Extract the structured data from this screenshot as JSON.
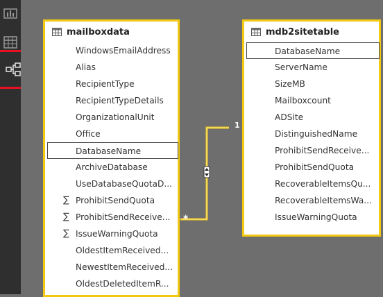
{
  "sidebar": {
    "icons": [
      {
        "name": "report-view-icon",
        "selected": false
      },
      {
        "name": "data-view-icon",
        "selected": false
      },
      {
        "name": "relationships-view-icon",
        "selected": true
      }
    ]
  },
  "tables": {
    "mailboxdata": {
      "title": "mailboxdata",
      "fields": [
        {
          "label": "WindowsEmailAddress",
          "sum": false,
          "selected": false
        },
        {
          "label": "Alias",
          "sum": false,
          "selected": false
        },
        {
          "label": "RecipientType",
          "sum": false,
          "selected": false
        },
        {
          "label": "RecipientTypeDetails",
          "sum": false,
          "selected": false
        },
        {
          "label": "OrganizationalUnit",
          "sum": false,
          "selected": false
        },
        {
          "label": "Office",
          "sum": false,
          "selected": false
        },
        {
          "label": "DatabaseName",
          "sum": false,
          "selected": true
        },
        {
          "label": "ArchiveDatabase",
          "sum": false,
          "selected": false
        },
        {
          "label": "UseDatabaseQuotaD...",
          "sum": false,
          "selected": false
        },
        {
          "label": "ProhibitSendQuota",
          "sum": true,
          "selected": false
        },
        {
          "label": "ProhibitSendReceive...",
          "sum": true,
          "selected": false
        },
        {
          "label": "IssueWarningQuota",
          "sum": true,
          "selected": false
        },
        {
          "label": "OldestItemReceived...",
          "sum": false,
          "selected": false
        },
        {
          "label": "NewestItemReceived...",
          "sum": false,
          "selected": false
        },
        {
          "label": "OldestDeletedItemR...",
          "sum": false,
          "selected": false
        }
      ]
    },
    "mdb2sitetable": {
      "title": "mdb2sitetable",
      "fields": [
        {
          "label": "DatabaseName",
          "sum": false,
          "selected": true
        },
        {
          "label": "ServerName",
          "sum": false,
          "selected": false
        },
        {
          "label": "SizeMB",
          "sum": false,
          "selected": false
        },
        {
          "label": "Mailboxcount",
          "sum": false,
          "selected": false
        },
        {
          "label": "ADSite",
          "sum": false,
          "selected": false
        },
        {
          "label": "DistinguishedName",
          "sum": false,
          "selected": false
        },
        {
          "label": "ProhibitSendReceive...",
          "sum": false,
          "selected": false
        },
        {
          "label": "ProhibitSendQuota",
          "sum": false,
          "selected": false
        },
        {
          "label": "RecoverableItemsQu...",
          "sum": false,
          "selected": false
        },
        {
          "label": "RecoverableItemsWa...",
          "sum": false,
          "selected": false
        },
        {
          "label": "IssueWarningQuota",
          "sum": false,
          "selected": false
        }
      ]
    }
  },
  "relationship": {
    "one_label": "1",
    "many_label": "*",
    "cross_filter": "both",
    "color": "#f2c811"
  },
  "colors": {
    "sidebar_bg": "#2f2f2f",
    "canvas_bg": "#6e6e6e",
    "card_border": "#f2c811",
    "selected_nav_border": "#e81123"
  }
}
